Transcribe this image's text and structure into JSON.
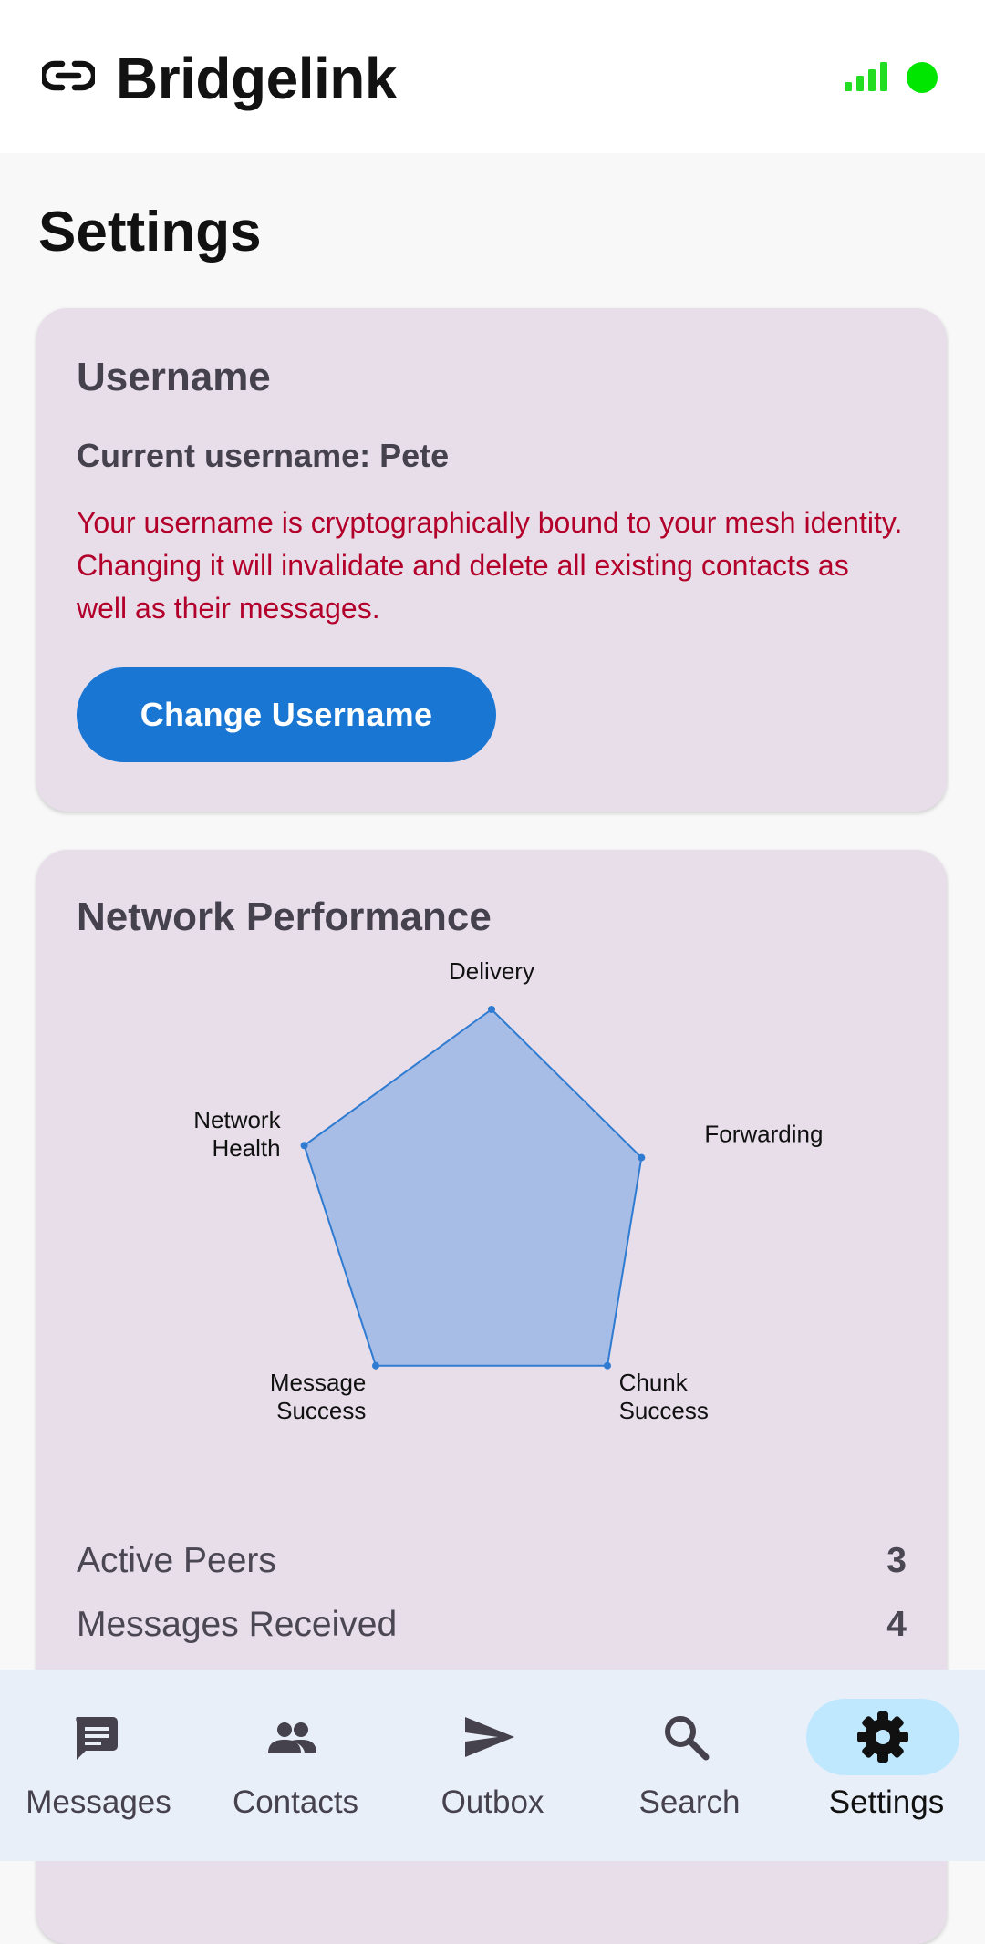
{
  "app": {
    "title": "Bridgelink",
    "status_color": "#00e600",
    "signal_color": "#22dd22"
  },
  "page": {
    "title": "Settings"
  },
  "username_card": {
    "title": "Username",
    "current_label": "Current username: Pete",
    "warning": "Your username is cryptographically bound to your mesh identity. Changing it will invalidate and delete all existing contacts as well as their messages.",
    "button_label": "Change Username"
  },
  "network_card": {
    "title": "Network Performance",
    "metrics": [
      {
        "label": "Active Peers",
        "value": "3"
      },
      {
        "label": "Messages Received",
        "value": "4"
      }
    ]
  },
  "chart_data": {
    "type": "radar",
    "axes": [
      "Delivery",
      "Forwarding",
      "Chunk Success",
      "Message Success",
      "Network Health"
    ],
    "axis_label_lines": [
      [
        "Delivery"
      ],
      [
        "Forwarding"
      ],
      [
        "Chunk",
        "Success"
      ],
      [
        "Message",
        "Success"
      ],
      [
        "Network",
        "Health"
      ]
    ],
    "values": [
      1.0,
      0.8,
      1.0,
      1.0,
      1.0
    ],
    "range": [
      0,
      1
    ],
    "fill_color": "#a8bde5",
    "stroke_color": "#2e7bd1"
  },
  "bottom_nav": {
    "active_index": 4,
    "pill_color": "#bfe8ff",
    "items": [
      {
        "label": "Messages",
        "icon": "message-icon"
      },
      {
        "label": "Contacts",
        "icon": "people-icon"
      },
      {
        "label": "Outbox",
        "icon": "send-icon"
      },
      {
        "label": "Search",
        "icon": "search-icon"
      },
      {
        "label": "Settings",
        "icon": "gear-icon"
      }
    ]
  }
}
